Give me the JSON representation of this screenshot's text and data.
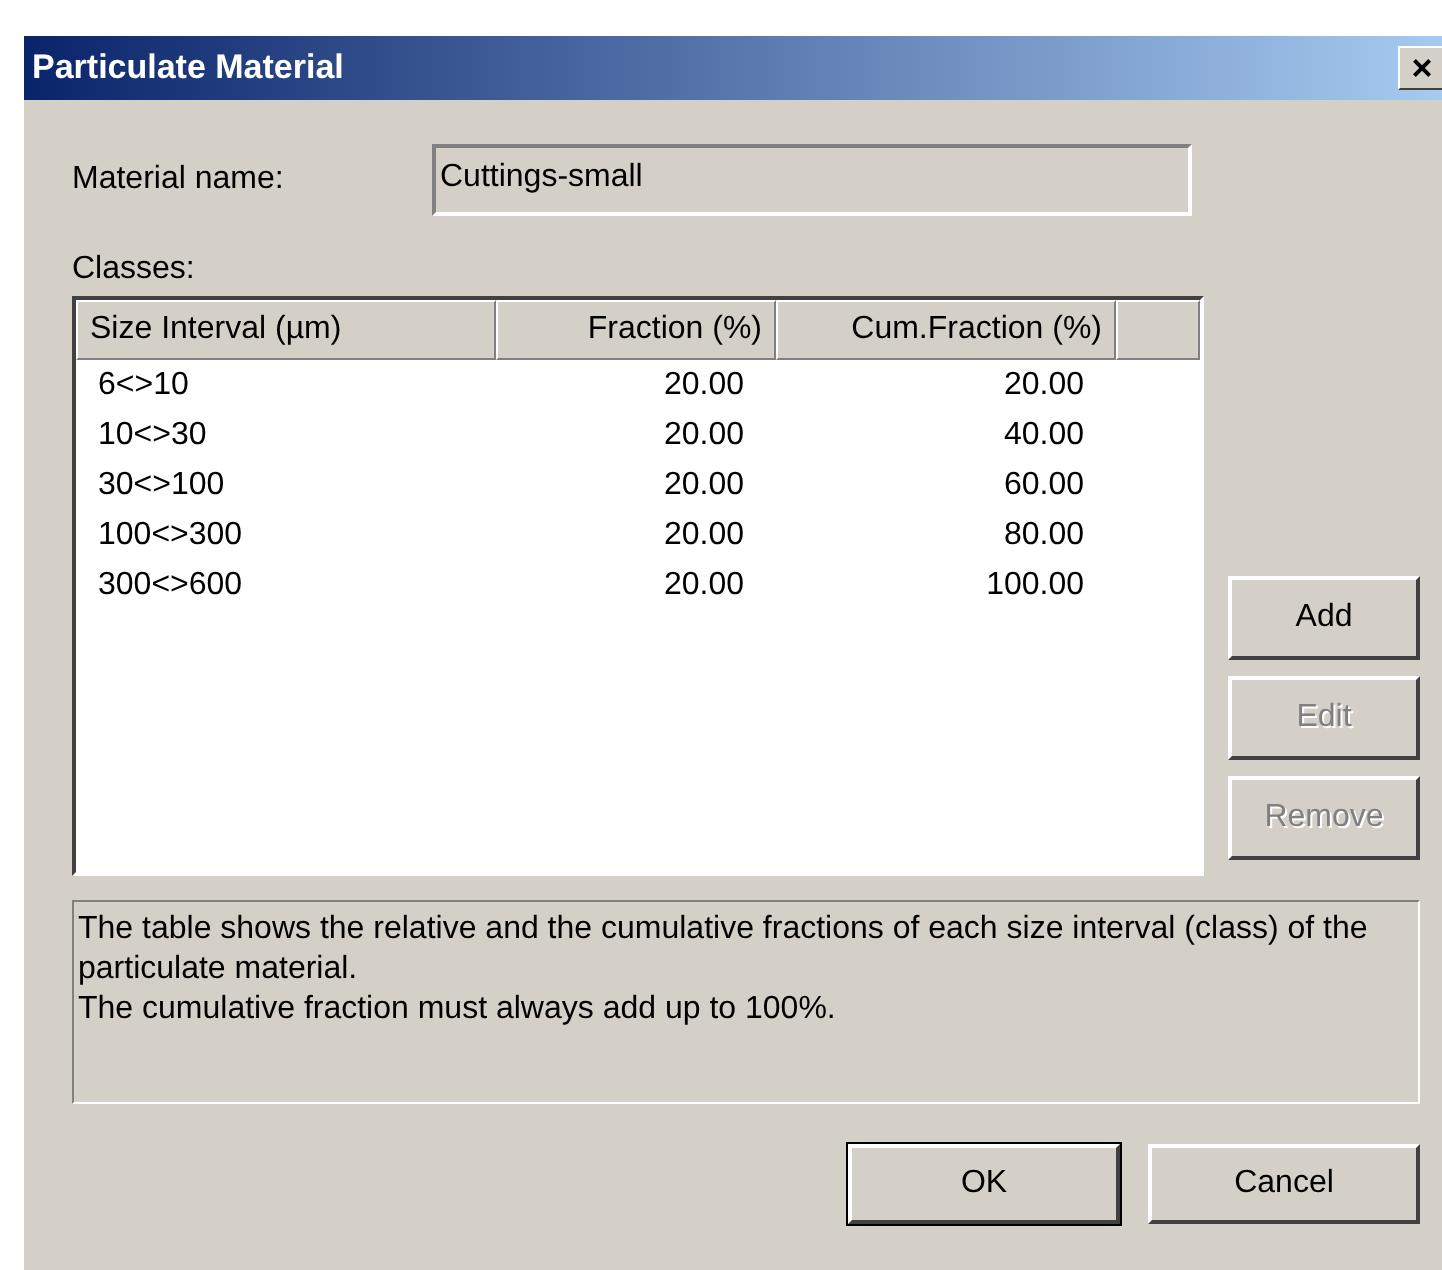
{
  "window": {
    "title": "Particulate Material",
    "close": "×"
  },
  "material": {
    "label": "Material name:",
    "value": "Cuttings-small"
  },
  "classes_label": "Classes:",
  "table": {
    "columns": [
      "Size Interval (µm)",
      "Fraction (%)",
      "Cum.Fraction (%)"
    ],
    "rows": [
      {
        "interval": "6<>10",
        "fraction": "20.00",
        "cumulative": "20.00"
      },
      {
        "interval": "10<>30",
        "fraction": "20.00",
        "cumulative": "40.00"
      },
      {
        "interval": "30<>100",
        "fraction": "20.00",
        "cumulative": "60.00"
      },
      {
        "interval": "100<>300",
        "fraction": "20.00",
        "cumulative": "80.00"
      },
      {
        "interval": "300<>600",
        "fraction": "20.00",
        "cumulative": "100.00"
      }
    ]
  },
  "side_buttons": [
    {
      "label": "Add",
      "disabled": false
    },
    {
      "label": "Edit",
      "disabled": true
    },
    {
      "label": "Remove",
      "disabled": true
    }
  ],
  "description": "The table shows the relative and the cumulative fractions of each size interval (class) of the particulate material.\nThe cumulative fraction must always add up to 100%.",
  "buttons": [
    {
      "label": "OK",
      "default": true
    },
    {
      "label": "Cancel",
      "default": false
    }
  ]
}
